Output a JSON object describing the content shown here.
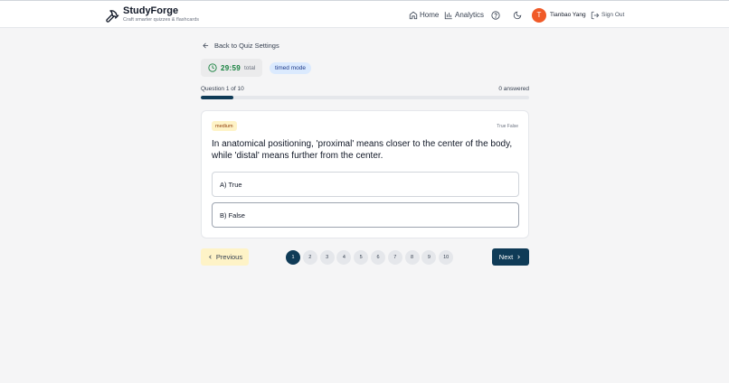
{
  "brand": {
    "name": "StudyForge",
    "tagline": "Craft smarter quizzes & flashcards"
  },
  "nav": {
    "home": "Home",
    "analytics": "Analytics",
    "user_initial": "T",
    "user_name": "Tianbao Yang",
    "sign_out": "Sign Out"
  },
  "quiz": {
    "back_label": "Back to Quiz Settings",
    "timer": "29:59",
    "timer_label": "total",
    "mode": "timed mode",
    "progress_text": "Question 1 of 10",
    "answered_text": "0 answered",
    "progress_fraction": 0.1,
    "question": {
      "difficulty": "medium",
      "type": "True False",
      "text": "In anatomical positioning, 'proximal' means closer to the center of the body, while 'distal' means further from the center.",
      "options": [
        "A) True",
        "B) False"
      ]
    },
    "prev_label": "Previous",
    "next_label": "Next",
    "pages": [
      "1",
      "2",
      "3",
      "4",
      "5",
      "6",
      "7",
      "8",
      "9",
      "10"
    ],
    "current_page": 1
  },
  "colors": {
    "primary": "#0f3b57",
    "avatar": "#f05a28",
    "timer": "#15803d",
    "badge_mode": "#dbeafe",
    "badge_difficulty": "#fef3c7"
  }
}
